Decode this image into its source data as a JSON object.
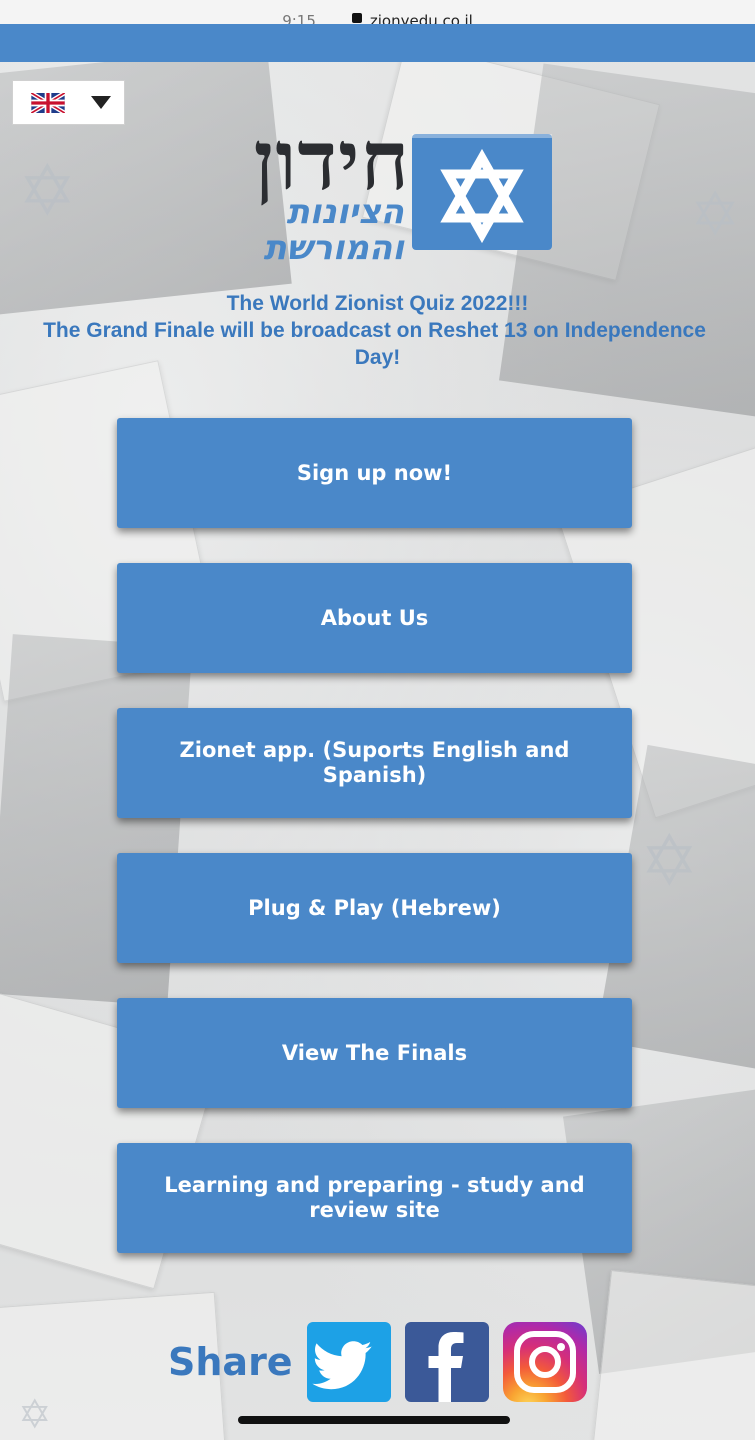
{
  "status_bar": {
    "time": "9:15",
    "url": "zionyedu.co.il"
  },
  "language_selector": {
    "selected": "English",
    "flag_icon": "uk-flag-icon"
  },
  "logo": {
    "line1": "חידון",
    "line2": "הציונות",
    "line3": "והמורשת",
    "brand_color": "#4a88c9"
  },
  "headline": {
    "line1": "The World Zionist Quiz 2022!!!",
    "line2": "The Grand Finale will be broadcast on Reshet 13 on Independence",
    "line3": "Day!"
  },
  "buttons": [
    {
      "label": "Sign up now!"
    },
    {
      "label": "About Us"
    },
    {
      "label": "Zionet app. (Suports English and Spanish)"
    },
    {
      "label": "Plug & Play (Hebrew)"
    },
    {
      "label": "View The Finals"
    },
    {
      "label": "Learning and preparing - study and review site"
    }
  ],
  "share": {
    "label": "Share",
    "icons": [
      "twitter-icon",
      "facebook-icon",
      "instagram-icon"
    ]
  },
  "colors": {
    "accent": "#4a88c9",
    "headline": "#3a78bd"
  }
}
